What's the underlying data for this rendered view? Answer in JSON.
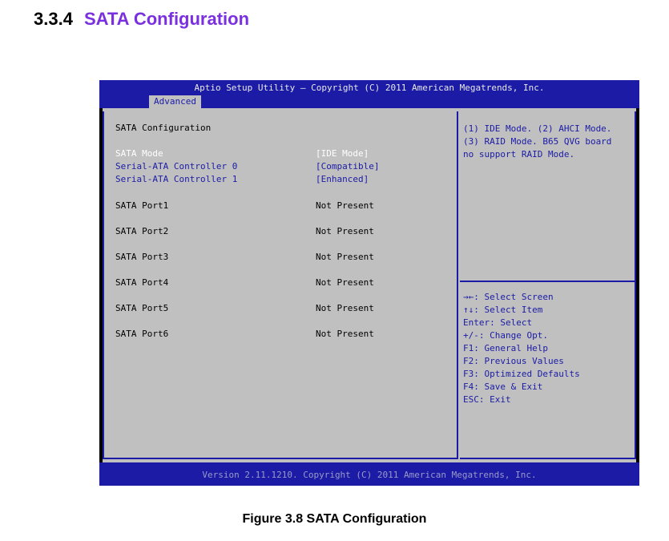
{
  "section": {
    "number": "3.3.4",
    "title": "SATA Configuration"
  },
  "bios": {
    "copyright_top": "Aptio Setup Utility – Copyright (C) 2011 American Megatrends, Inc.",
    "active_tab": "Advanced",
    "page_heading": "SATA Configuration",
    "settings": [
      {
        "label": "SATA Mode",
        "value": "[IDE Mode]"
      },
      {
        "label": "Serial-ATA Controller 0",
        "value": "[Compatible]"
      },
      {
        "label": "Serial-ATA Controller 1",
        "value": "[Enhanced]"
      }
    ],
    "ports": [
      {
        "label": "SATA Port1",
        "status": "Not Present"
      },
      {
        "label": "SATA Port2",
        "status": "Not Present"
      },
      {
        "label": "SATA Port3",
        "status": "Not Present"
      },
      {
        "label": "SATA Port4",
        "status": "Not Present"
      },
      {
        "label": "SATA Port5",
        "status": "Not Present"
      },
      {
        "label": "SATA Port6",
        "status": "Not Present"
      }
    ],
    "help_text": "(1) IDE Mode. (2) AHCI Mode.\n(3) RAID Mode. B65 QVG board\nno support RAID Mode.",
    "key_help": [
      "→←: Select Screen",
      "↑↓: Select Item",
      "Enter: Select",
      "+/-: Change Opt.",
      "F1: General Help",
      "F2: Previous Values",
      "F3: Optimized Defaults",
      "F4: Save & Exit",
      "ESC: Exit"
    ],
    "version_bottom": "Version 2.11.1210. Copyright (C) 2011 American Megatrends, Inc."
  },
  "caption": "Figure 3.8 SATA Configuration",
  "colors": {
    "bios_blue": "#1b1ba6",
    "bios_gray": "#c0c0c0",
    "heading_purple": "#7a2fe0"
  }
}
